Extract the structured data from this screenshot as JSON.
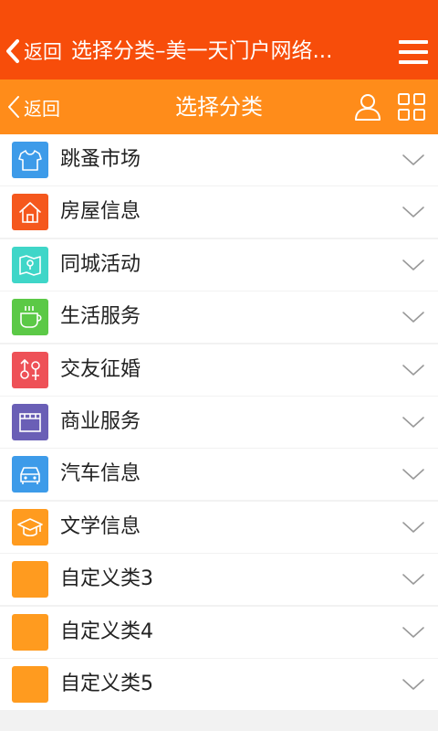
{
  "top_bar": {
    "back_label": "返回",
    "title": "选择分类–美一天门户网络...",
    "color": "#f74d0a"
  },
  "sub_bar": {
    "back_label": "返回",
    "title": "选择分类",
    "color": "#ff8c1a"
  },
  "categories": [
    {
      "label": "跳蚤市场",
      "icon": "tshirt-icon",
      "color": "#3d9be9"
    },
    {
      "label": "房屋信息",
      "icon": "house-icon",
      "color": "#f5581d"
    },
    {
      "label": "同城活动",
      "icon": "map-icon",
      "color": "#3fd6c8"
    },
    {
      "label": "生活服务",
      "icon": "cup-icon",
      "color": "#5bc946"
    },
    {
      "label": "交友征婚",
      "icon": "gender-icon",
      "color": "#ee5157"
    },
    {
      "label": "商业服务",
      "icon": "store-icon",
      "color": "#6a5fb6"
    },
    {
      "label": "汽车信息",
      "icon": "car-icon",
      "color": "#3d9be9"
    },
    {
      "label": "文学信息",
      "icon": "graduation-cap-icon",
      "color": "#ff9b1f"
    },
    {
      "label": "自定义类3",
      "icon": "blank-icon",
      "color": "#ff9b1f"
    },
    {
      "label": "自定义类4",
      "icon": "blank-icon",
      "color": "#ff9b1f"
    },
    {
      "label": "自定义类5",
      "icon": "blank-icon",
      "color": "#ff9b1f"
    }
  ]
}
